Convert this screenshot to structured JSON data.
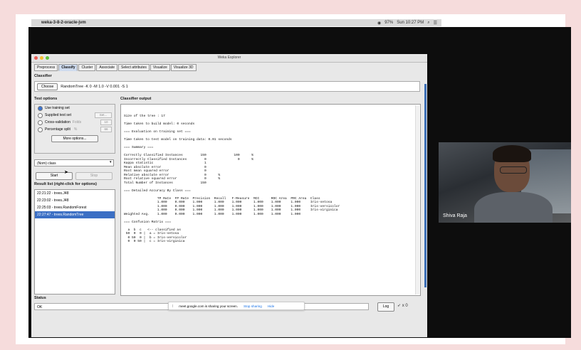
{
  "menubar": {
    "app_name": "weka-3-8-2-oracle-jvm",
    "battery": "97%",
    "clock": "Sun 10:27 PM"
  },
  "window": {
    "title": "Weka Explorer"
  },
  "tabs": [
    "Preprocess",
    "Classify",
    "Cluster",
    "Associate",
    "Select attributes",
    "Visualize",
    "Visualize 3D"
  ],
  "classifier": {
    "section_label": "Classifier",
    "choose_label": "Choose",
    "command": "RandomTree -K 0 -M 1.0 -V 0.001 -S 1"
  },
  "test_options": {
    "section_label": "Test options",
    "use_training": "Use training set",
    "supplied": "Supplied test set",
    "supplied_btn": "Set...",
    "cross_validation": "Cross-validation",
    "folds_label": "Folds",
    "folds_value": "10",
    "percentage": "Percentage split",
    "percent_label": "%",
    "percent_value": "66",
    "more_options": "More options..."
  },
  "class_select": "(Nom) class",
  "start_label": "Start",
  "stop_label": "Stop",
  "result_list": {
    "label": "Result list (right-click for options)",
    "items": [
      {
        "text": "22:21:22 - trees.J48",
        "selected": false
      },
      {
        "text": "22:23:02 - trees.J48",
        "selected": false
      },
      {
        "text": "22:25:03 - trees.RandomForest",
        "selected": false
      },
      {
        "text": "22:27:47 - trees.RandomTree",
        "selected": true
      }
    ]
  },
  "output": {
    "label": "Classifier output",
    "lines": [
      "Size of the tree : 17",
      "",
      "Time taken to build model: 0 seconds",
      "",
      "=== Evaluation on training set ===",
      "",
      "Time taken to test model on training data: 0.01 seconds",
      "",
      "=== Summary ===",
      "",
      "Correctly Classified Instances         150              100      %",
      "Incorrectly Classified Instances         0                0      %",
      "Kappa statistic                          1",
      "Mean absolute error                      0",
      "Root mean squared error                  0",
      "Relative absolute error                  0      %",
      "Root relative squared error              0      %",
      "Total Number of Instances              150",
      "",
      "=== Detailed Accuracy By Class ===",
      "",
      "                 TP Rate  FP Rate  Precision  Recall   F-Measure  MCC      ROC Area  PRC Area  Class",
      "                 1.000    0.000    1.000      1.000    1.000      1.000    1.000     1.000     Iris-setosa",
      "                 1.000    0.000    1.000      1.000    1.000      1.000    1.000     1.000     Iris-versicolor",
      "                 1.000    0.000    1.000      1.000    1.000      1.000    1.000     1.000     Iris-virginica",
      "Weighted Avg.    1.000    0.000    1.000      1.000    1.000      1.000    1.000     1.000",
      "",
      "=== Confusion Matrix ===",
      "",
      "  a  b  c   <-- classified as",
      " 50  0  0 |  a = Iris-setosa",
      "  0 50  0 |  b = Iris-versicolor",
      "  0  0 50 |  c = Iris-virginica"
    ]
  },
  "status": {
    "label": "Status",
    "value": "OK",
    "log_label": "Log",
    "x_count": "x 0"
  },
  "share_bar": {
    "message": "meet.google.com is sharing your screen.",
    "stop": "Stop sharing",
    "hide": "Hide"
  },
  "video": {
    "participant": "Shiva Raja"
  },
  "colors": {
    "selection": "#3b6fc4",
    "tab_active": "#cfdcef"
  }
}
